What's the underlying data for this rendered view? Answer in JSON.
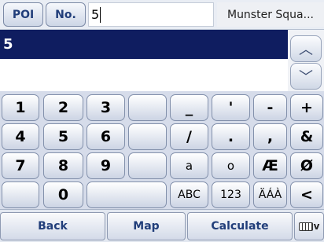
{
  "topbar": {
    "poi_label": "POI",
    "no_label": "No.",
    "number_value": "5",
    "street_name": "Munster Squa..."
  },
  "results": {
    "items": [
      "5"
    ]
  },
  "scroll": {
    "up_icon": "chevron-up-icon",
    "down_icon": "chevron-down-icon",
    "up_glyph": "︿",
    "down_glyph": "﹀"
  },
  "keyboard": {
    "rows": [
      [
        "1",
        "2",
        "3",
        "",
        "_",
        "'",
        "-",
        "+"
      ],
      [
        "4",
        "5",
        "6",
        "",
        "/",
        ".",
        ",",
        "&"
      ],
      [
        "7",
        "8",
        "9",
        "",
        "a",
        "o",
        "Æ",
        "Ø"
      ],
      [
        "",
        "0",
        "",
        "ABC",
        "123",
        "ÄÁÀ",
        "<"
      ]
    ]
  },
  "bottombar": {
    "back_label": "Back",
    "map_label": "Map",
    "calculate_label": "Calculate",
    "keyboard_toggle_suffix": "v"
  }
}
